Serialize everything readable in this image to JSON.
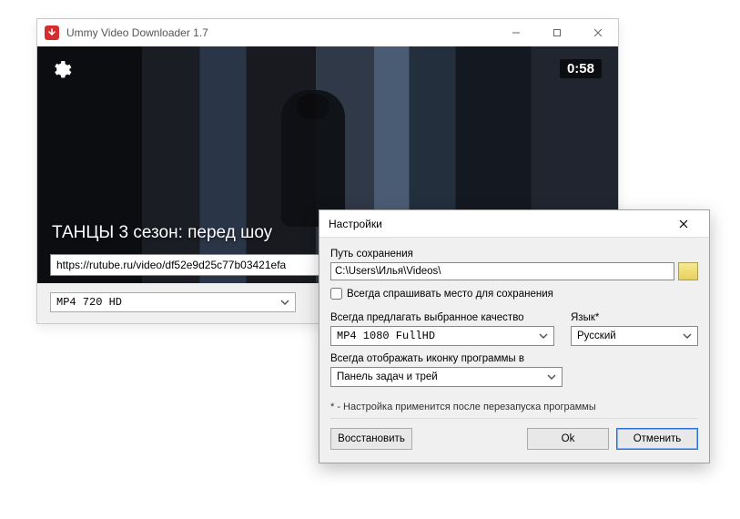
{
  "window": {
    "title": "Ummy Video Downloader 1.7"
  },
  "video": {
    "timestamp": "0:58",
    "title": "ТАНЦЫ 3 сезон: перед шоу",
    "url": "https://rutube.ru/video/df52e9d25c77b03421efa"
  },
  "format": {
    "selected": "MP4  720  HD"
  },
  "dialog": {
    "title": "Настройки",
    "save_path_label": "Путь сохранения",
    "save_path": "C:\\Users\\Илья\\Videos\\",
    "ask_location_label": "Всегда спрашивать место для сохранения",
    "ask_location_checked": false,
    "quality_label": "Всегда предлагать выбранное качество",
    "quality_selected": "MP4  1080  FullHD",
    "language_label": "Язык*",
    "language_selected": "Русский",
    "tray_label": "Всегда отображать иконку программы в",
    "tray_selected": "Панель задач и трей",
    "footnote": "* - Настройка применится после перезапуска программы",
    "restore_label": "Восстановить",
    "ok_label": "Ok",
    "cancel_label": "Отменить"
  }
}
